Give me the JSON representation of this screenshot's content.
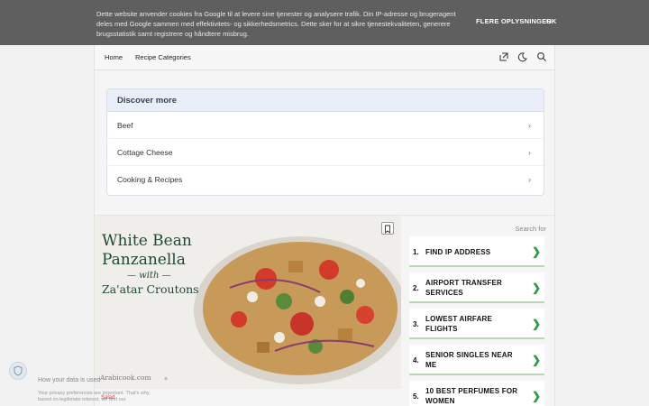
{
  "cookie_bar": {
    "text": "Dette website anvender cookies fra Google til at levere sine tjenester og analysere trafik. Din IP-adresse og brugeragent deles med Google sammen med effektivitets- og sikkerhedsmetrics. Dette sker for at sikre tjenestekvaliteten, generere brugsstatistik samt registrere og håndtere misbrug.",
    "more_label": "FLERE OPLYSNINGER",
    "ok_label": "OK"
  },
  "nav": {
    "links": [
      "Home",
      "Recipe Categories"
    ],
    "icons": [
      "share-icon",
      "dark-mode-icon",
      "search-icon"
    ]
  },
  "discover": {
    "heading": "Discover more",
    "items": [
      "Beef",
      "Cottage Cheese",
      "Cooking & Recipes"
    ]
  },
  "hero": {
    "title_line1": "White Bean",
    "title_line2": "Panzanella",
    "title_with": "— with —",
    "title_sub": "Za'atar Croutons",
    "credit": "Arabicook.com"
  },
  "ads": {
    "search_label": "Search for",
    "items": [
      {
        "num": "1.",
        "label": "FIND IP ADDRESS"
      },
      {
        "num": "2.",
        "label": "AIRPORT TRANSFER SERVICES"
      },
      {
        "num": "3.",
        "label": "LOWEST AIRFARE FLIGHTS"
      },
      {
        "num": "4.",
        "label": "SENIOR SINGLES NEAR ME"
      },
      {
        "num": "5.",
        "label": "10 BEST PERFUMES FOR WOMEN"
      }
    ],
    "accent_color": "#2f9a3a"
  },
  "privacy": {
    "heading": "How your data is used",
    "text": "Your privacy preferences are important. That's why, based on legitimate interest, we and our",
    "button": "Salad"
  }
}
